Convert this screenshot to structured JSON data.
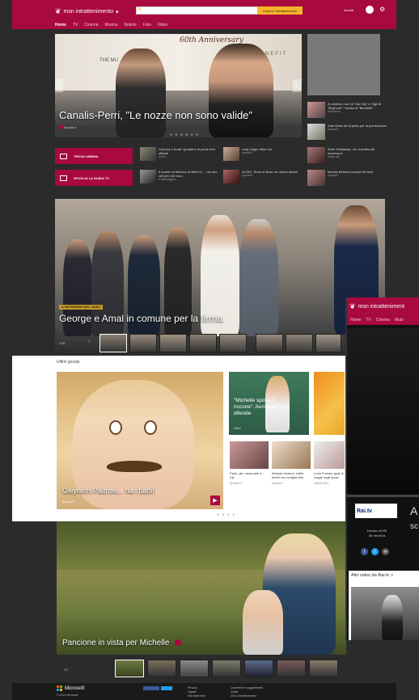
{
  "header": {
    "brand": "msn intrattenimento",
    "search_button": "Cerca in Intrattenimento",
    "user": "Accedi"
  },
  "nav": [
    "Home",
    "TV",
    "Cinema",
    "Musica",
    "Notizie",
    "Foto",
    "Video"
  ],
  "hero1": {
    "caption": "Canalis-Perri, \"Le nozze non sono valide\"",
    "source": "sportal.it",
    "banner": "60th Anniversary",
    "banner_sub": "BENEFIT",
    "brand_on_wall": "THE MU"
  },
  "side_list": [
    {
      "text": "Al cinema i duri di \"Sin City\" e i figli di \"Boyhood\" / freaks di \"Bennello\"",
      "src": "MyMovies"
    },
    {
      "text": "Kate Moss dà di petto per la prevenzione",
      "src": "sportal.it"
    },
    {
      "text": "Anne Hathaway: «Io, travolta dal successo»",
      "src": "vanity fair"
    },
    {
      "text": "Monica Bellucci compie 50 anni",
      "src": "sportal.it"
    }
  ],
  "buttons": {
    "cinema": "TROVA CINEMA",
    "tv_guide": "SFOGLIA LA GUIDA TV"
  },
  "news_grid": [
    {
      "text": "Clooney e Amal: spuntano le prime foto ufficiali",
      "src": "ANSA"
    },
    {
      "text": "Lady Gaga: falso hot",
      "src": "sportal.it"
    },
    {
      "text": "5 numeri di telefono di Belen è ... nel suo cell per 100 euro",
      "src": "Il Messaggero"
    },
    {
      "text": "AC/DC, Rock or Bust: un ritorno amaro",
      "src": "sportal.it"
    }
  ],
  "hero2": {
    "tag": "IL MATRIMONIO DELL'ANNO",
    "caption": "George e Amal in comune per la firma",
    "counter": "1/20"
  },
  "gossip": {
    "title": "Ultimi gossip",
    "main_caption": "Gwyneth Paltrow... ha i baffi!",
    "main_src": "SportalTV",
    "michelle_card": "\"Michelle sposa il riccone\". Aurora la difende",
    "michelle_src": "Video",
    "minis": [
      {
        "text": "Paris, giù, nazionale a... Vip",
        "src": "SportalTV"
      },
      {
        "text": "Alessia Ventura, selfie teneri con la figlia Mia",
        "src": "sportal.it"
      },
      {
        "text": "Luna Foresa: guai di magie sugli sposi",
        "src": "Vanità 2000"
      }
    ]
  },
  "overlay": {
    "brand": "msn intratteniment",
    "nav": [
      "Home",
      "TV",
      "Cinema",
      "Musi"
    ],
    "rai_logo": "Rai.tv",
    "big_letter": "A",
    "big_so": "sc",
    "durata_label": "Durata: 00:00",
    "durata_sub": "36 minuti fa",
    "altri_title": "Altri video da Rai.tv >"
  },
  "hero3": {
    "caption": "Pancione in vista per Michelle",
    "counter": "1/7"
  },
  "footer": {
    "brand": "Microsoft",
    "sub": "© 2014 Microsoft",
    "cols": [
      [
        "Privacy",
        "Legale",
        "Info inserzioni"
      ],
      [
        "Commenti e suggerimenti",
        "Guida",
        "2014 Intrattenimento"
      ]
    ]
  },
  "colors": {
    "accent": "#a8093f",
    "search_button": "#f5b32a"
  }
}
